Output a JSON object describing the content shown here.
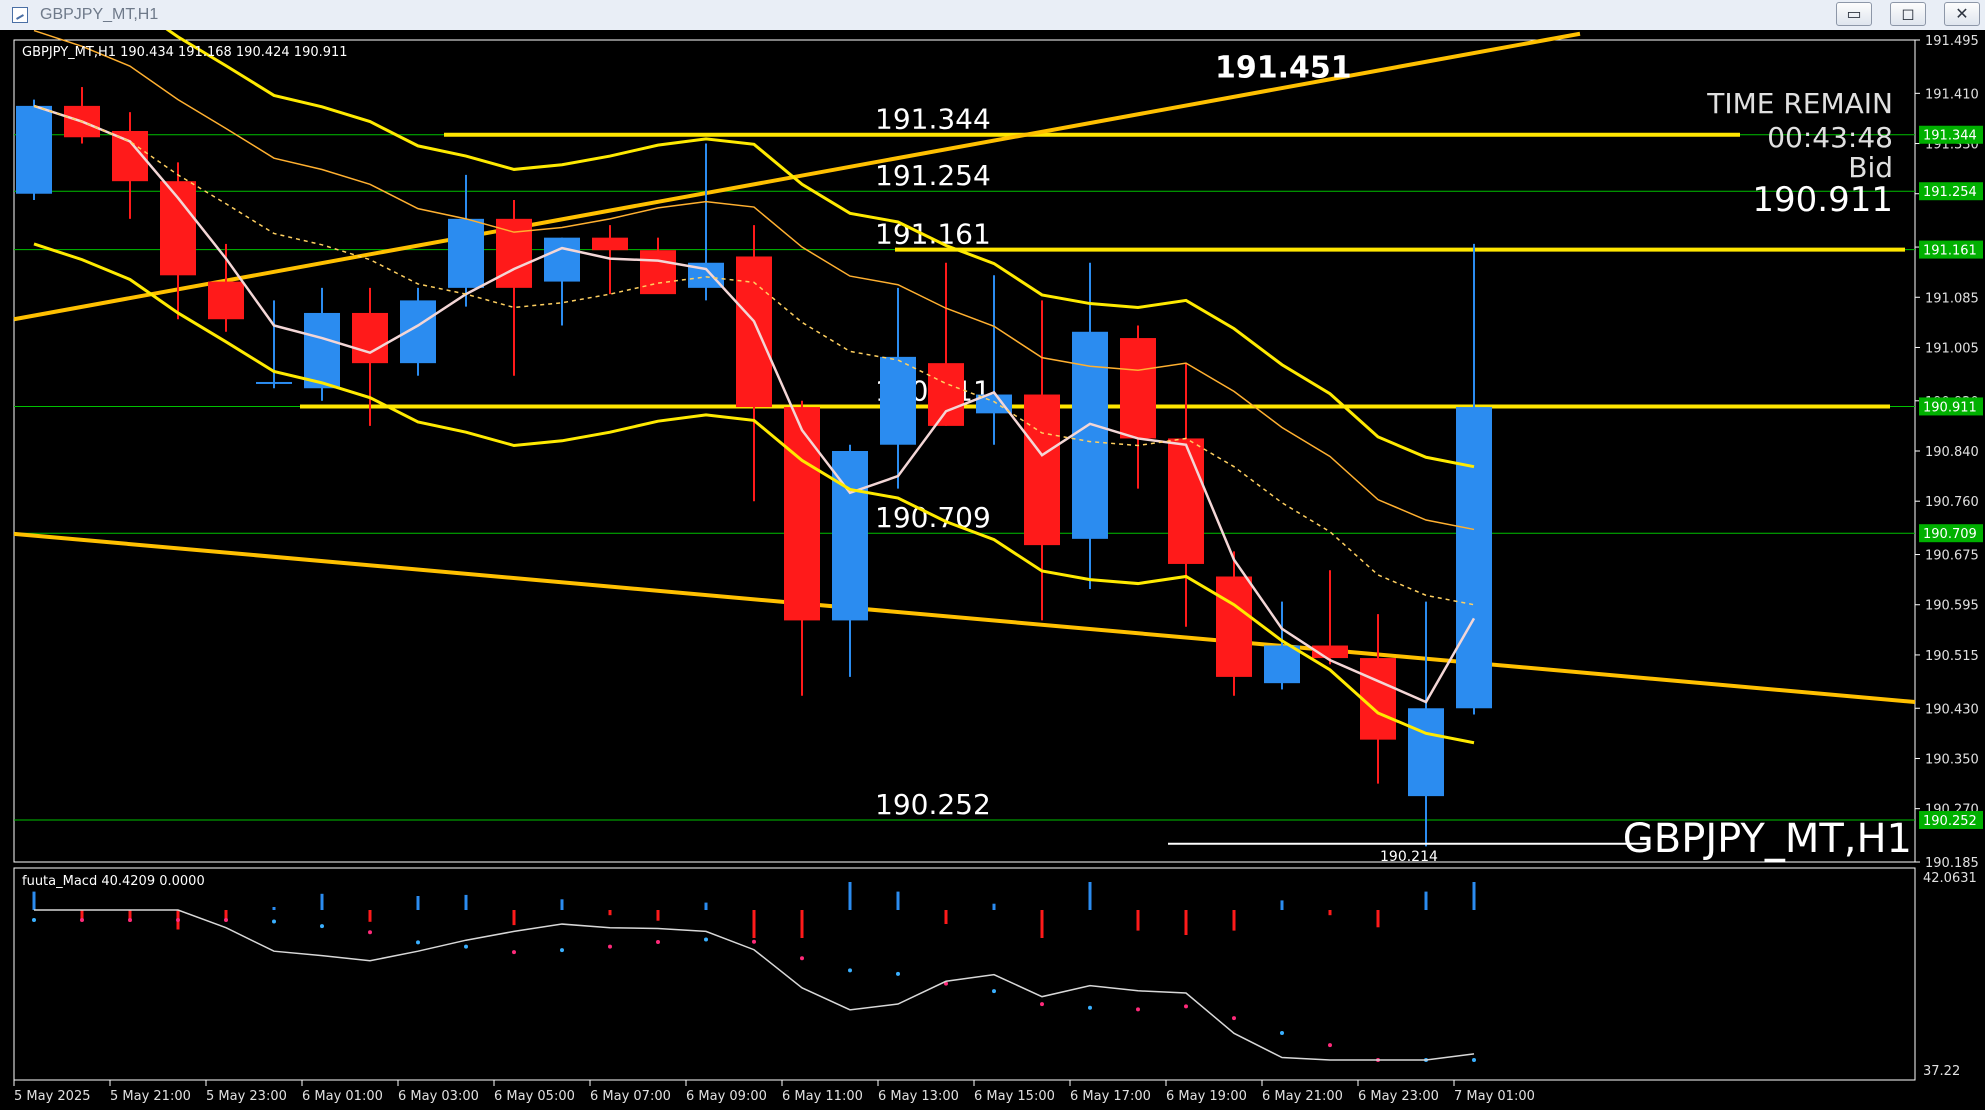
{
  "window": {
    "title": "GBPJPY_MT,H1",
    "minimize_glyph": "▭",
    "restore_glyph": "◻",
    "close_glyph": "✕"
  },
  "chart": {
    "header": "GBPJPY_MT,H1  190.434 191.168 190.424 190.911",
    "symbol_watermark": "GBPJPY_MT,H1",
    "time_remain_label": "TIME REMAIN",
    "time_remain_value": "00:43:48",
    "bid_label": "Bid",
    "bid_value": "190.911",
    "high_label": "191.451",
    "low_label": "190.214",
    "price_axis": [
      "191.495",
      "191.410",
      "191.330",
      "191.250",
      "191.165",
      "191.085",
      "191.005",
      "190.920",
      "190.840",
      "190.760",
      "190.675",
      "190.595",
      "190.515",
      "190.430",
      "190.350",
      "190.270",
      "190.185"
    ],
    "level_lines": [
      {
        "value": "191.344",
        "color": "#ffea00"
      },
      {
        "value": "191.254",
        "color": "#00c000"
      },
      {
        "value": "191.161",
        "color": "#ffea00"
      },
      {
        "value": "190.911",
        "color": "#ffea00"
      },
      {
        "value": "190.709",
        "color": "#00c000"
      },
      {
        "value": "190.252",
        "color": "#00c000"
      }
    ],
    "time_axis": [
      "5 May 2025",
      "5 May 21:00",
      "5 May 23:00",
      "6 May 01:00",
      "6 May 03:00",
      "6 May 05:00",
      "6 May 07:00",
      "6 May 09:00",
      "6 May 11:00",
      "6 May 13:00",
      "6 May 15:00",
      "6 May 17:00",
      "6 May 19:00",
      "6 May 21:00",
      "6 May 23:00",
      "7 May 01:00"
    ],
    "colors": {
      "bull": "#2b8cf0",
      "bear": "#ff1a1a",
      "background": "#000000",
      "grid_level": "#00c000",
      "trend": "#ffc000",
      "band": "#ffea00"
    }
  },
  "chart_data": {
    "type": "candlestick",
    "title": "GBPJPY_MT,H1",
    "ylim": [
      190.185,
      191.495
    ],
    "candles": [
      {
        "o": 191.25,
        "h": 191.4,
        "l": 191.24,
        "c": 191.39
      },
      {
        "o": 191.39,
        "h": 191.42,
        "l": 191.33,
        "c": 191.34
      },
      {
        "o": 191.35,
        "h": 191.38,
        "l": 191.21,
        "c": 191.27
      },
      {
        "o": 191.27,
        "h": 191.3,
        "l": 191.05,
        "c": 191.12
      },
      {
        "o": 191.11,
        "h": 191.17,
        "l": 191.03,
        "c": 191.05
      },
      {
        "o": 190.95,
        "h": 191.08,
        "l": 190.94,
        "c": 190.95
      },
      {
        "o": 190.94,
        "h": 191.1,
        "l": 190.92,
        "c": 191.06
      },
      {
        "o": 191.06,
        "h": 191.1,
        "l": 190.88,
        "c": 190.98
      },
      {
        "o": 190.98,
        "h": 191.1,
        "l": 190.96,
        "c": 191.08
      },
      {
        "o": 191.1,
        "h": 191.28,
        "l": 191.07,
        "c": 191.21
      },
      {
        "o": 191.21,
        "h": 191.24,
        "l": 190.96,
        "c": 191.1
      },
      {
        "o": 191.11,
        "h": 191.18,
        "l": 191.04,
        "c": 191.18
      },
      {
        "o": 191.18,
        "h": 191.2,
        "l": 191.09,
        "c": 191.16
      },
      {
        "o": 191.16,
        "h": 191.18,
        "l": 191.1,
        "c": 191.09
      },
      {
        "o": 191.1,
        "h": 191.33,
        "l": 191.08,
        "c": 191.14
      },
      {
        "o": 191.15,
        "h": 191.2,
        "l": 190.76,
        "c": 190.91
      },
      {
        "o": 190.91,
        "h": 190.92,
        "l": 190.45,
        "c": 190.57
      },
      {
        "o": 190.57,
        "h": 190.85,
        "l": 190.48,
        "c": 190.84
      },
      {
        "o": 190.85,
        "h": 191.1,
        "l": 190.78,
        "c": 190.99
      },
      {
        "o": 190.98,
        "h": 191.14,
        "l": 190.88,
        "c": 190.88
      },
      {
        "o": 190.9,
        "h": 191.12,
        "l": 190.85,
        "c": 190.93
      },
      {
        "o": 190.93,
        "h": 191.08,
        "l": 190.57,
        "c": 190.69
      },
      {
        "o": 190.7,
        "h": 191.14,
        "l": 190.62,
        "c": 191.03
      },
      {
        "o": 191.02,
        "h": 191.04,
        "l": 190.78,
        "c": 190.86
      },
      {
        "o": 190.86,
        "h": 190.98,
        "l": 190.56,
        "c": 190.66
      },
      {
        "o": 190.64,
        "h": 190.68,
        "l": 190.45,
        "c": 190.48
      },
      {
        "o": 190.47,
        "h": 190.6,
        "l": 190.46,
        "c": 190.53
      },
      {
        "o": 190.53,
        "h": 190.65,
        "l": 190.5,
        "c": 190.51
      },
      {
        "o": 190.51,
        "h": 190.58,
        "l": 190.31,
        "c": 190.38
      },
      {
        "o": 190.29,
        "h": 190.6,
        "l": 190.21,
        "c": 190.43
      },
      {
        "o": 190.43,
        "h": 191.17,
        "l": 190.42,
        "c": 190.91
      }
    ],
    "macd": {
      "label": "fuuta_Macd 40.4209  0.0000",
      "ylim": [
        37.22,
        42.0631
      ],
      "axis": [
        "42.0631",
        "37.22"
      ]
    }
  }
}
